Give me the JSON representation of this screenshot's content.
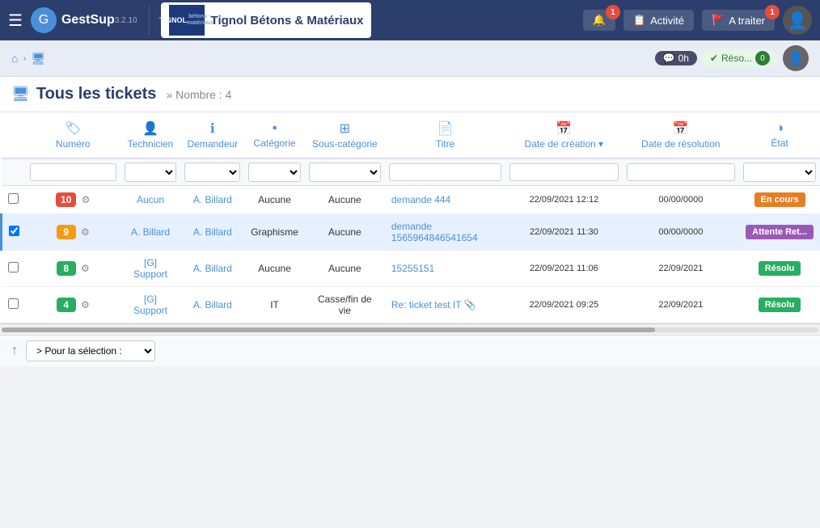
{
  "app": {
    "name": "GestSup",
    "version": "3.2.10",
    "company_name": "Tignol Bétons & Matériaux",
    "company_short": "TIGNOL\nbétons – matériaux"
  },
  "nav": {
    "hamburger_icon": "☰",
    "bell_label": "Notifications",
    "bell_badge": "1",
    "activity_label": "Activité",
    "flag_label": "A traiter",
    "flag_badge": "1",
    "timer": "0h",
    "resolve_count": "0",
    "resolve_label": "Réso..."
  },
  "breadcrumb": {
    "home_icon": "⌂",
    "ticket_icon": "🖥"
  },
  "page": {
    "title": "Tous les tickets",
    "subtitle": "» Nombre : 4",
    "title_icon": "🖥"
  },
  "table": {
    "columns": [
      {
        "id": "numero",
        "label": "Numéro",
        "icon": "🏷"
      },
      {
        "id": "technicien",
        "label": "Technicien",
        "icon": "👤"
      },
      {
        "id": "demandeur",
        "label": "Demandeur",
        "icon": "ℹ"
      },
      {
        "id": "categorie",
        "label": "Catégorie",
        "icon": "▪"
      },
      {
        "id": "sous-categorie",
        "label": "Sous-catégorie",
        "icon": "⊞"
      },
      {
        "id": "titre",
        "label": "Titre",
        "icon": "📄"
      },
      {
        "id": "date-creation",
        "label": "Date de création ▾",
        "icon": "📅"
      },
      {
        "id": "date-resolution",
        "label": "Date de résolution",
        "icon": "📅"
      },
      {
        "id": "etat",
        "label": "État",
        "icon": "◑"
      }
    ],
    "rows": [
      {
        "id": 10,
        "num_color": "#e74c3c",
        "technicien": "Aucun",
        "demandeur": "A. Billard",
        "categorie": "Aucune",
        "sous_categorie": "Aucune",
        "titre": "demande 444",
        "date_creation": "22/09/2021 12:12",
        "date_resolution": "00/00/0000",
        "etat": "En cours",
        "etat_class": "status-en-cours",
        "has_attachment": false
      },
      {
        "id": 9,
        "num_color": "#f39c12",
        "technicien": "A. Billard",
        "demandeur": "A. Billard",
        "categorie": "Graphisme",
        "sous_categorie": "Aucune",
        "titre": "demande 1565964846541654",
        "date_creation": "22/09/2021 11:30",
        "date_resolution": "00/00/0000",
        "etat": "Attente Ret...",
        "etat_class": "status-attente",
        "has_attachment": false,
        "selected": true
      },
      {
        "id": 8,
        "num_color": "#27ae60",
        "technicien": "[G] Support",
        "demandeur": "A. Billard",
        "categorie": "Aucune",
        "sous_categorie": "Aucune",
        "titre": "15255151",
        "date_creation": "22/09/2021 11:06",
        "date_resolution": "22/09/2021",
        "etat": "Résolu",
        "etat_class": "status-resolu",
        "has_attachment": false
      },
      {
        "id": 4,
        "num_color": "#27ae60",
        "technicien": "[G] Support",
        "demandeur": "A. Billard",
        "categorie": "IT",
        "sous_categorie": "Casse/fin de vie",
        "titre": "Re: ticket test IT",
        "date_creation": "22/09/2021 09:25",
        "date_resolution": "22/09/2021",
        "etat": "Résolu",
        "etat_class": "status-resolu",
        "has_attachment": true
      }
    ]
  },
  "bottom": {
    "arrow_icon": "↑",
    "select_label": "> Pour la sélection :",
    "select_options": [
      "> Pour la sélection :"
    ]
  }
}
